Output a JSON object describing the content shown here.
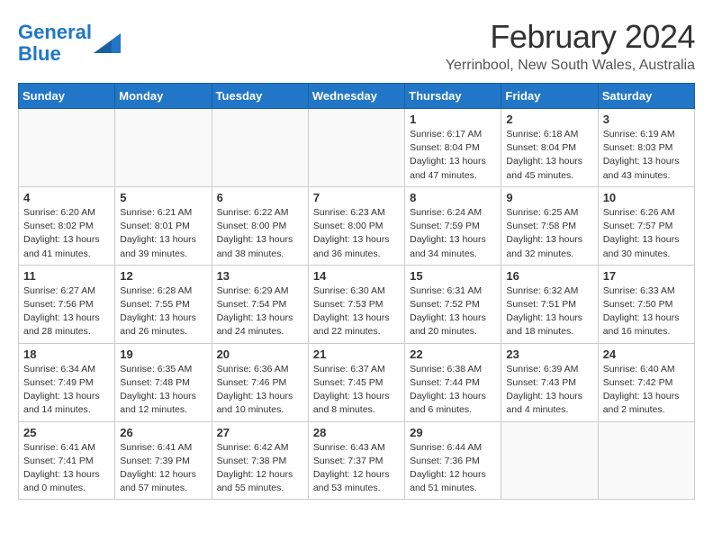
{
  "logo": {
    "text_general": "General",
    "text_blue": "Blue"
  },
  "title": "February 2024",
  "subtitle": "Yerrinbool, New South Wales, Australia",
  "headers": [
    "Sunday",
    "Monday",
    "Tuesday",
    "Wednesday",
    "Thursday",
    "Friday",
    "Saturday"
  ],
  "weeks": [
    [
      {
        "day": "",
        "content": ""
      },
      {
        "day": "",
        "content": ""
      },
      {
        "day": "",
        "content": ""
      },
      {
        "day": "",
        "content": ""
      },
      {
        "day": "1",
        "content": "Sunrise: 6:17 AM\nSunset: 8:04 PM\nDaylight: 13 hours\nand 47 minutes."
      },
      {
        "day": "2",
        "content": "Sunrise: 6:18 AM\nSunset: 8:04 PM\nDaylight: 13 hours\nand 45 minutes."
      },
      {
        "day": "3",
        "content": "Sunrise: 6:19 AM\nSunset: 8:03 PM\nDaylight: 13 hours\nand 43 minutes."
      }
    ],
    [
      {
        "day": "4",
        "content": "Sunrise: 6:20 AM\nSunset: 8:02 PM\nDaylight: 13 hours\nand 41 minutes."
      },
      {
        "day": "5",
        "content": "Sunrise: 6:21 AM\nSunset: 8:01 PM\nDaylight: 13 hours\nand 39 minutes."
      },
      {
        "day": "6",
        "content": "Sunrise: 6:22 AM\nSunset: 8:00 PM\nDaylight: 13 hours\nand 38 minutes."
      },
      {
        "day": "7",
        "content": "Sunrise: 6:23 AM\nSunset: 8:00 PM\nDaylight: 13 hours\nand 36 minutes."
      },
      {
        "day": "8",
        "content": "Sunrise: 6:24 AM\nSunset: 7:59 PM\nDaylight: 13 hours\nand 34 minutes."
      },
      {
        "day": "9",
        "content": "Sunrise: 6:25 AM\nSunset: 7:58 PM\nDaylight: 13 hours\nand 32 minutes."
      },
      {
        "day": "10",
        "content": "Sunrise: 6:26 AM\nSunset: 7:57 PM\nDaylight: 13 hours\nand 30 minutes."
      }
    ],
    [
      {
        "day": "11",
        "content": "Sunrise: 6:27 AM\nSunset: 7:56 PM\nDaylight: 13 hours\nand 28 minutes."
      },
      {
        "day": "12",
        "content": "Sunrise: 6:28 AM\nSunset: 7:55 PM\nDaylight: 13 hours\nand 26 minutes."
      },
      {
        "day": "13",
        "content": "Sunrise: 6:29 AM\nSunset: 7:54 PM\nDaylight: 13 hours\nand 24 minutes."
      },
      {
        "day": "14",
        "content": "Sunrise: 6:30 AM\nSunset: 7:53 PM\nDaylight: 13 hours\nand 22 minutes."
      },
      {
        "day": "15",
        "content": "Sunrise: 6:31 AM\nSunset: 7:52 PM\nDaylight: 13 hours\nand 20 minutes."
      },
      {
        "day": "16",
        "content": "Sunrise: 6:32 AM\nSunset: 7:51 PM\nDaylight: 13 hours\nand 18 minutes."
      },
      {
        "day": "17",
        "content": "Sunrise: 6:33 AM\nSunset: 7:50 PM\nDaylight: 13 hours\nand 16 minutes."
      }
    ],
    [
      {
        "day": "18",
        "content": "Sunrise: 6:34 AM\nSunset: 7:49 PM\nDaylight: 13 hours\nand 14 minutes."
      },
      {
        "day": "19",
        "content": "Sunrise: 6:35 AM\nSunset: 7:48 PM\nDaylight: 13 hours\nand 12 minutes."
      },
      {
        "day": "20",
        "content": "Sunrise: 6:36 AM\nSunset: 7:46 PM\nDaylight: 13 hours\nand 10 minutes."
      },
      {
        "day": "21",
        "content": "Sunrise: 6:37 AM\nSunset: 7:45 PM\nDaylight: 13 hours\nand 8 minutes."
      },
      {
        "day": "22",
        "content": "Sunrise: 6:38 AM\nSunset: 7:44 PM\nDaylight: 13 hours\nand 6 minutes."
      },
      {
        "day": "23",
        "content": "Sunrise: 6:39 AM\nSunset: 7:43 PM\nDaylight: 13 hours\nand 4 minutes."
      },
      {
        "day": "24",
        "content": "Sunrise: 6:40 AM\nSunset: 7:42 PM\nDaylight: 13 hours\nand 2 minutes."
      }
    ],
    [
      {
        "day": "25",
        "content": "Sunrise: 6:41 AM\nSunset: 7:41 PM\nDaylight: 13 hours\nand 0 minutes."
      },
      {
        "day": "26",
        "content": "Sunrise: 6:41 AM\nSunset: 7:39 PM\nDaylight: 12 hours\nand 57 minutes."
      },
      {
        "day": "27",
        "content": "Sunrise: 6:42 AM\nSunset: 7:38 PM\nDaylight: 12 hours\nand 55 minutes."
      },
      {
        "day": "28",
        "content": "Sunrise: 6:43 AM\nSunset: 7:37 PM\nDaylight: 12 hours\nand 53 minutes."
      },
      {
        "day": "29",
        "content": "Sunrise: 6:44 AM\nSunset: 7:36 PM\nDaylight: 12 hours\nand 51 minutes."
      },
      {
        "day": "",
        "content": ""
      },
      {
        "day": "",
        "content": ""
      }
    ]
  ]
}
